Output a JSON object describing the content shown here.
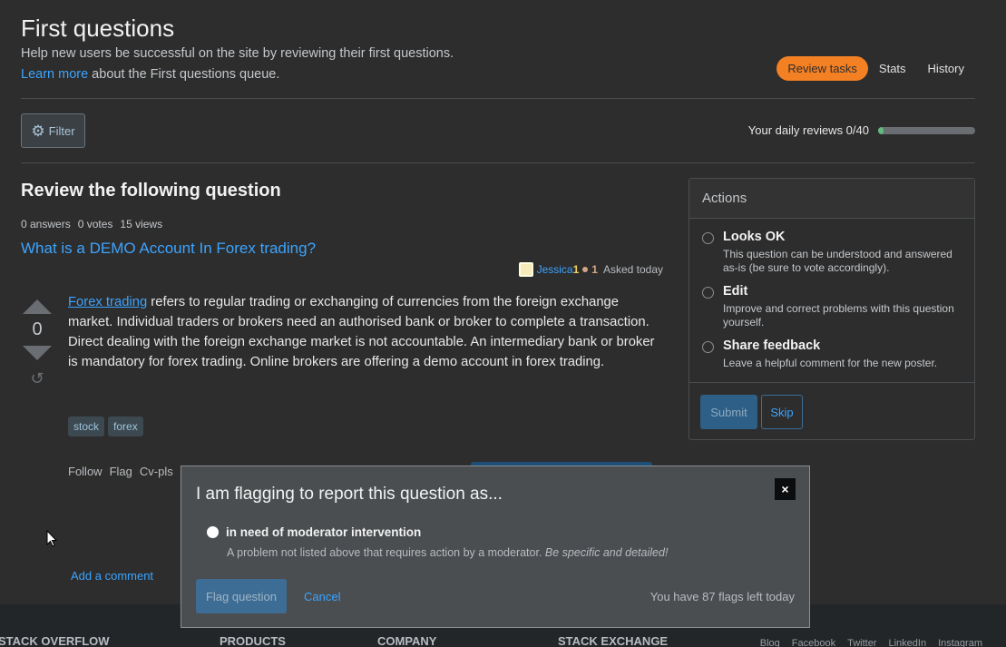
{
  "header": {
    "title": "First questions",
    "subtitle": "Help new users be successful on the site by reviewing their first questions.",
    "learn_more_link": "Learn more",
    "learn_more_suffix": " about the First questions queue."
  },
  "tabs": [
    {
      "label": "Review tasks",
      "active": true
    },
    {
      "label": "Stats",
      "active": false
    },
    {
      "label": "History",
      "active": false
    }
  ],
  "toolbar": {
    "filter_label": "Filter",
    "filter_icon": "gear-icon",
    "daily_reviews_label": "Your daily reviews 0/40",
    "daily_reviews_done": 0,
    "daily_reviews_limit": 40,
    "progress_color": "#5eba7d"
  },
  "review": {
    "heading": "Review the following question",
    "stats": {
      "answers": "0 answers",
      "votes": "0 votes",
      "views": "15 views"
    },
    "question_title": "What is a DEMO Account In Forex trading?",
    "owner": {
      "name": "Jessica",
      "reputation": "1",
      "bronze_badges": "1",
      "asked": "Asked today"
    },
    "vote_count": "0",
    "body_link": "Forex trading",
    "body_text": " refers to regular trading or exchanging of currencies from the foreign exchange market. Individual traders or brokers need an authorised bank or broker to complete a transaction. Direct dealing with the foreign exchange market is not accountable. An intermediary bank or broker is mandatory for forex trading. Online brokers are offering a demo account in forex trading.",
    "tags": [
      "stock",
      "forex"
    ],
    "post_menu": [
      "Follow",
      "Flag",
      "Cv-pls"
    ],
    "add_comment": "Add a comment"
  },
  "actions": {
    "header": "Actions",
    "options": [
      {
        "label": "Looks OK",
        "description": "This question can be understood and answered as-is (be sure to vote accordingly)."
      },
      {
        "label": "Edit",
        "description": "Improve and correct problems with this question yourself."
      },
      {
        "label": "Share feedback",
        "description": "Leave a helpful comment for the new poster."
      }
    ],
    "submit_label": "Submit",
    "skip_label": "Skip"
  },
  "flag_dialog": {
    "title": "I am flagging to report this question as...",
    "close_label": "×",
    "option_label": "in need of moderator intervention",
    "option_description": "A problem not listed above that requires action by a moderator. ",
    "option_description_emphasis": "Be specific and detailed!",
    "flag_button": "Flag question",
    "cancel_label": "Cancel",
    "flags_remaining": "You have 87 flags left today"
  },
  "footer": {
    "columns": [
      "STACK OVERFLOW",
      "PRODUCTS",
      "COMPANY",
      "STACK EXCHANGE"
    ],
    "social_links": [
      "Blog",
      "Facebook",
      "Twitter",
      "LinkedIn",
      "Instagram"
    ]
  },
  "colors": {
    "accent_orange": "#f48024",
    "link_blue": "#3ca4ff",
    "background": "#2d2d2d"
  }
}
